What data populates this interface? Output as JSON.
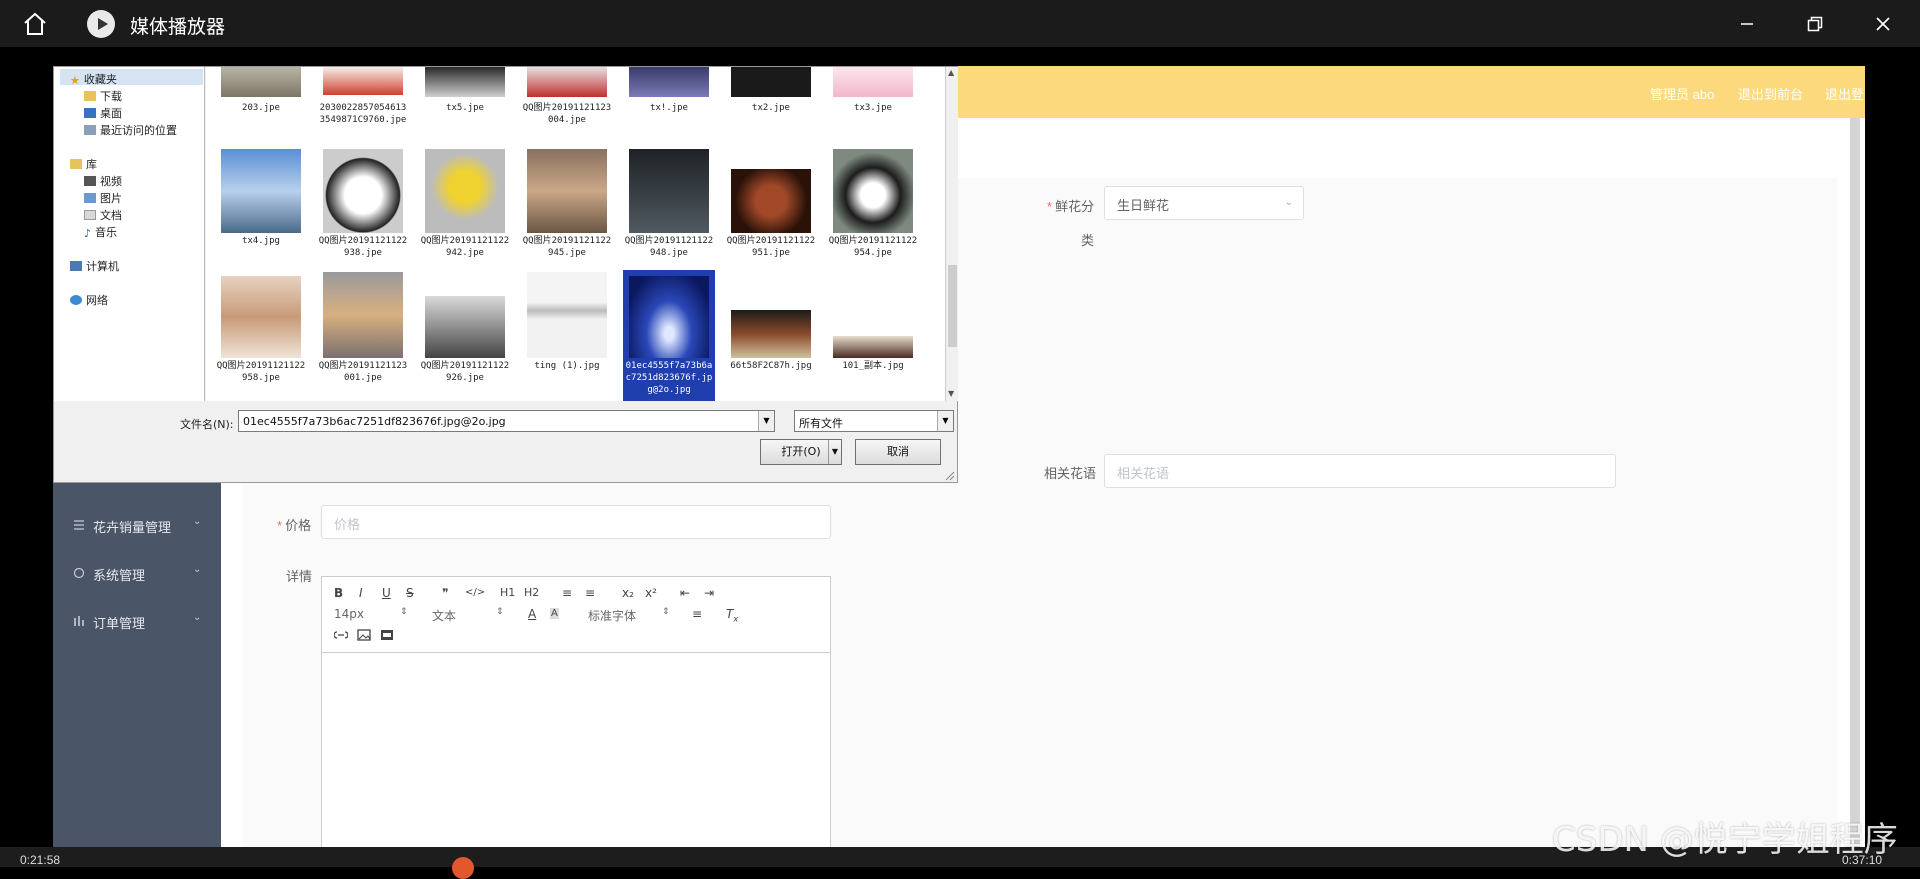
{
  "player": {
    "title": "媒体播放器",
    "time_elapsed": "0:21:58",
    "time_total": "0:37:10",
    "watermark": "CSDN @悦宁学姐程序"
  },
  "app": {
    "header_links": [
      "管理员 abo",
      "退出到前台",
      "退出登录"
    ],
    "sidebar": [
      {
        "label": "花卉销量管理",
        "icon": "list-icon"
      },
      {
        "label": "系统管理",
        "icon": "settings-icon"
      },
      {
        "label": "订单管理",
        "icon": "bar-chart-icon"
      }
    ],
    "form": {
      "category_label_1": "鲜花分",
      "category_label_2": "类",
      "category_value": "生日鲜花",
      "flower_lang_label": "相关花语",
      "flower_lang_placeholder": "相关花语",
      "price_label": "价格",
      "price_placeholder": "价格",
      "detail_label": "详情"
    },
    "editor": {
      "row1": [
        "B",
        "I",
        "U",
        "S",
        "❞",
        "</>",
        "H1",
        "H2",
        "≡",
        "≡",
        "x₂",
        "x²",
        "⇤",
        "⇥"
      ],
      "font_size": "14px",
      "text_style": "文本",
      "font_family": "标准字体"
    }
  },
  "dialog": {
    "tree": [
      "收藏夹",
      "下载",
      "桌面",
      "最近访问的位置",
      "库",
      "视频",
      "图片",
      "文档",
      "音乐",
      "计算机",
      "网络"
    ],
    "files_row0": [
      "203.jpe",
      "20300228570546133549871C9760.jpe",
      "tx5.jpe",
      "QQ图片20191121123004.jpe",
      "tx!.jpe",
      "tx2.jpe",
      "tx3.jpe"
    ],
    "files_row1": [
      "tx4.jpg",
      "QQ图片20191121122938.jpe",
      "QQ图片20191121122942.jpe",
      "QQ图片20191121122945.jpe",
      "QQ图片20191121122948.jpe",
      "QQ图片20191121122951.jpe",
      "QQ图片20191121122954.jpe"
    ],
    "files_row2": [
      "QQ图片20191121122958.jpe",
      "QQ图片20191121123001.jpe",
      "QQ图片20191121122926.jpe",
      "ting (1).jpg",
      "01ec4555f7a73b6ac7251d823676f.jpg@2o.jpg",
      "66t58F2C87h.jpg",
      "101_副本.jpg"
    ],
    "filename_label": "文件名(N):",
    "filename_value": "01ec4555f7a73b6ac7251df823676f.jpg@2o.jpg",
    "filetype": "所有文件",
    "open_label": "打开(O)",
    "cancel_label": "取消"
  }
}
